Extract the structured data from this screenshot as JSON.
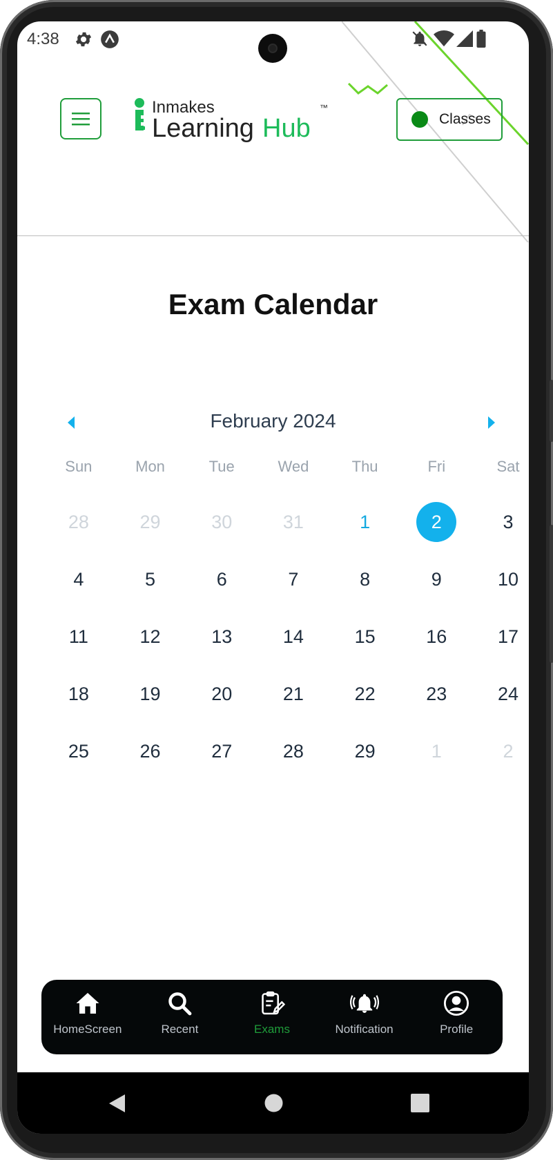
{
  "status_bar": {
    "time": "4:38"
  },
  "header": {
    "logo_top": "Inmakes",
    "logo_bottom_1": "Learning",
    "logo_bottom_2": "Hub",
    "logo_tm": "™",
    "classes_label": "Classes",
    "brand_color": "#1f9d3a",
    "classes_dot_color": "#0a8a16"
  },
  "page": {
    "title": "Exam Calendar"
  },
  "calendar": {
    "month_label": "February 2024",
    "weekdays": [
      "Sun",
      "Mon",
      "Tue",
      "Wed",
      "Thu",
      "Fri",
      "Sat"
    ],
    "accent_color": "#13b1ec",
    "days": [
      {
        "n": "28",
        "muted": true
      },
      {
        "n": "29",
        "muted": true
      },
      {
        "n": "30",
        "muted": true
      },
      {
        "n": "31",
        "muted": true
      },
      {
        "n": "1",
        "today": true
      },
      {
        "n": "2",
        "selected": true
      },
      {
        "n": "3"
      },
      {
        "n": "4"
      },
      {
        "n": "5"
      },
      {
        "n": "6"
      },
      {
        "n": "7"
      },
      {
        "n": "8"
      },
      {
        "n": "9"
      },
      {
        "n": "10"
      },
      {
        "n": "11"
      },
      {
        "n": "12"
      },
      {
        "n": "13"
      },
      {
        "n": "14"
      },
      {
        "n": "15"
      },
      {
        "n": "16"
      },
      {
        "n": "17"
      },
      {
        "n": "18"
      },
      {
        "n": "19"
      },
      {
        "n": "20"
      },
      {
        "n": "21"
      },
      {
        "n": "22"
      },
      {
        "n": "23"
      },
      {
        "n": "24"
      },
      {
        "n": "25"
      },
      {
        "n": "26"
      },
      {
        "n": "27"
      },
      {
        "n": "28"
      },
      {
        "n": "29"
      },
      {
        "n": "1",
        "muted": true
      },
      {
        "n": "2",
        "muted": true
      }
    ]
  },
  "bottom_nav": {
    "items": [
      {
        "label": "HomeScreen",
        "icon": "home-icon"
      },
      {
        "label": "Recent",
        "icon": "search-icon"
      },
      {
        "label": "Exams",
        "icon": "clipboard-edit-icon",
        "active": true
      },
      {
        "label": "Notification",
        "icon": "bell-ringing-icon"
      },
      {
        "label": "Profile",
        "icon": "profile-icon"
      }
    ]
  }
}
